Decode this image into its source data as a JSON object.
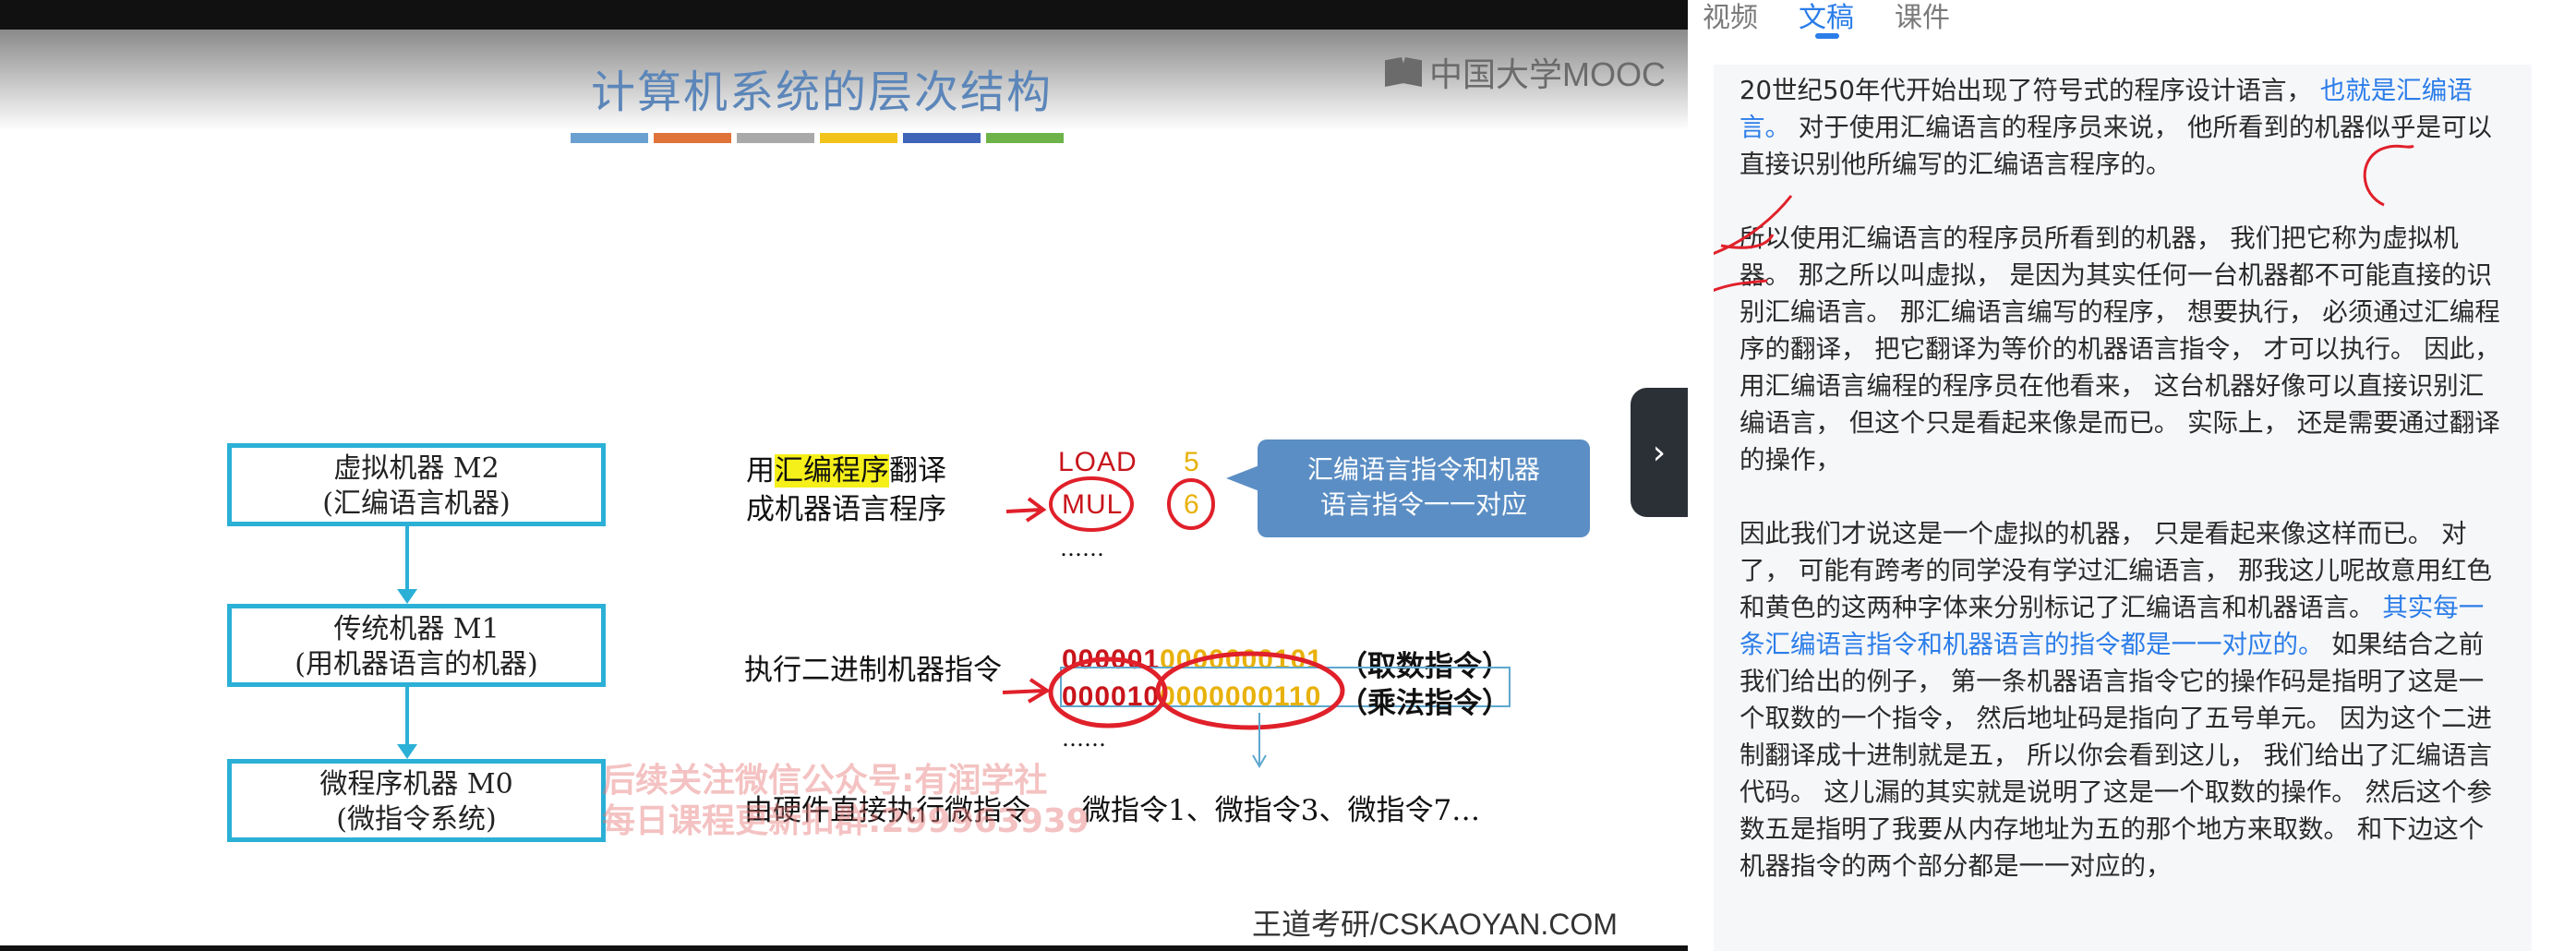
{
  "slide": {
    "title": "计算机系统的层次结构",
    "logo_text": "中国大学MOOC",
    "title_bar_colors": [
      "#6aa0d0",
      "#e0733a",
      "#a9a9a9",
      "#f2c31a",
      "#3e65b8",
      "#6db34a"
    ],
    "boxes": [
      {
        "line1": "虚拟机器 M2",
        "line2": "(汇编语言机器)"
      },
      {
        "line1": "传统机器 M1",
        "line2": "(用机器语言的机器)"
      },
      {
        "line1": "微程序机器 M0",
        "line2": "(微指令系统)"
      }
    ],
    "row1": {
      "pre": "用",
      "highlight": "汇编程序",
      "post": "翻译",
      "line2": "成机器语言程序",
      "op1": "LOAD",
      "op2": "MUL",
      "arg1": "5",
      "arg2": "6",
      "dots": "……",
      "callout_line1": "汇编语言指令和机器",
      "callout_line2": "语言指令一一对应"
    },
    "row2": {
      "label": "执行二进制机器指令",
      "code1_op": "000001",
      "code1_addr": "0000000101",
      "code1_note": "（取数指令）",
      "code2_op": "000010",
      "code2_addr": "0000000110",
      "code2_note": "（乘法指令）",
      "dots": "……"
    },
    "row3": {
      "label": "由硬件直接执行微指令",
      "micro": "微指令1、微指令3、微指令7…"
    },
    "watermark_line1": "后续关注微信公众号:有润学社",
    "watermark_line2": "每日课程更新扣群:299963939",
    "footer_brand": "王道考研/CSKAOYAN.COM"
  },
  "panel": {
    "tabs": [
      {
        "label": "视频",
        "active": false
      },
      {
        "label": "文稿",
        "active": true
      },
      {
        "label": "课件",
        "active": false
      }
    ],
    "paragraph1": {
      "text_a": "20世纪50年代开始出现了符号式的程序设计语言， ",
      "text_blue": "也就是汇编语言。",
      "text_b": " 对于使用汇编语言的程序员来说， 他所看到的机器似乎是可以直接识别他所编写的汇编语言程序的。"
    },
    "paragraph2": "所以使用汇编语言的程序员所看到的机器， 我们把它称为虚拟机器。 那之所以叫虚拟， 是因为其实任何一台机器都不可能直接的识别汇编语言。 那汇编语言编写的程序， 想要执行， 必须通过汇编程序的翻译， 把它翻译为等价的机器语言指令， 才可以执行。 因此， 用汇编语言编程的程序员在他看来， 这台机器好像可以直接识别汇编语言， 但这个只是看起来像是而已。 实际上， 还是需要通过翻译的操作，",
    "paragraph3": {
      "text_a": "因此我们才说这是一个虚拟的机器， 只是看起来像这样而已。 对了， 可能有跨考的同学没有学过汇编语言， 那我这儿呢故意用红色和黄色的这两种字体来分别标记了汇编语言和机器语言。",
      "text_blue": " 其实每一条汇编语言指令和机器语言的指令都是一一对应的。",
      "text_b": " 如果结合之前我们给出的例子， 第一条机器语言指令它的操作码是指明了这是一个取数的一个指令， 然后地址码是指向了五号单元。 因为这个二进制翻译成十进制就是五， 所以你会看到这儿， 我们给出了汇编语言代码。 这儿漏的其实就是说明了这是一个取数的操作。 然后这个参数五是指明了我要从内存地址为五的那个地方来取数。 和下边这个机器指令的两个部分都是一一对应的，"
    },
    "toggle_icon": "chevron-right-icon"
  }
}
